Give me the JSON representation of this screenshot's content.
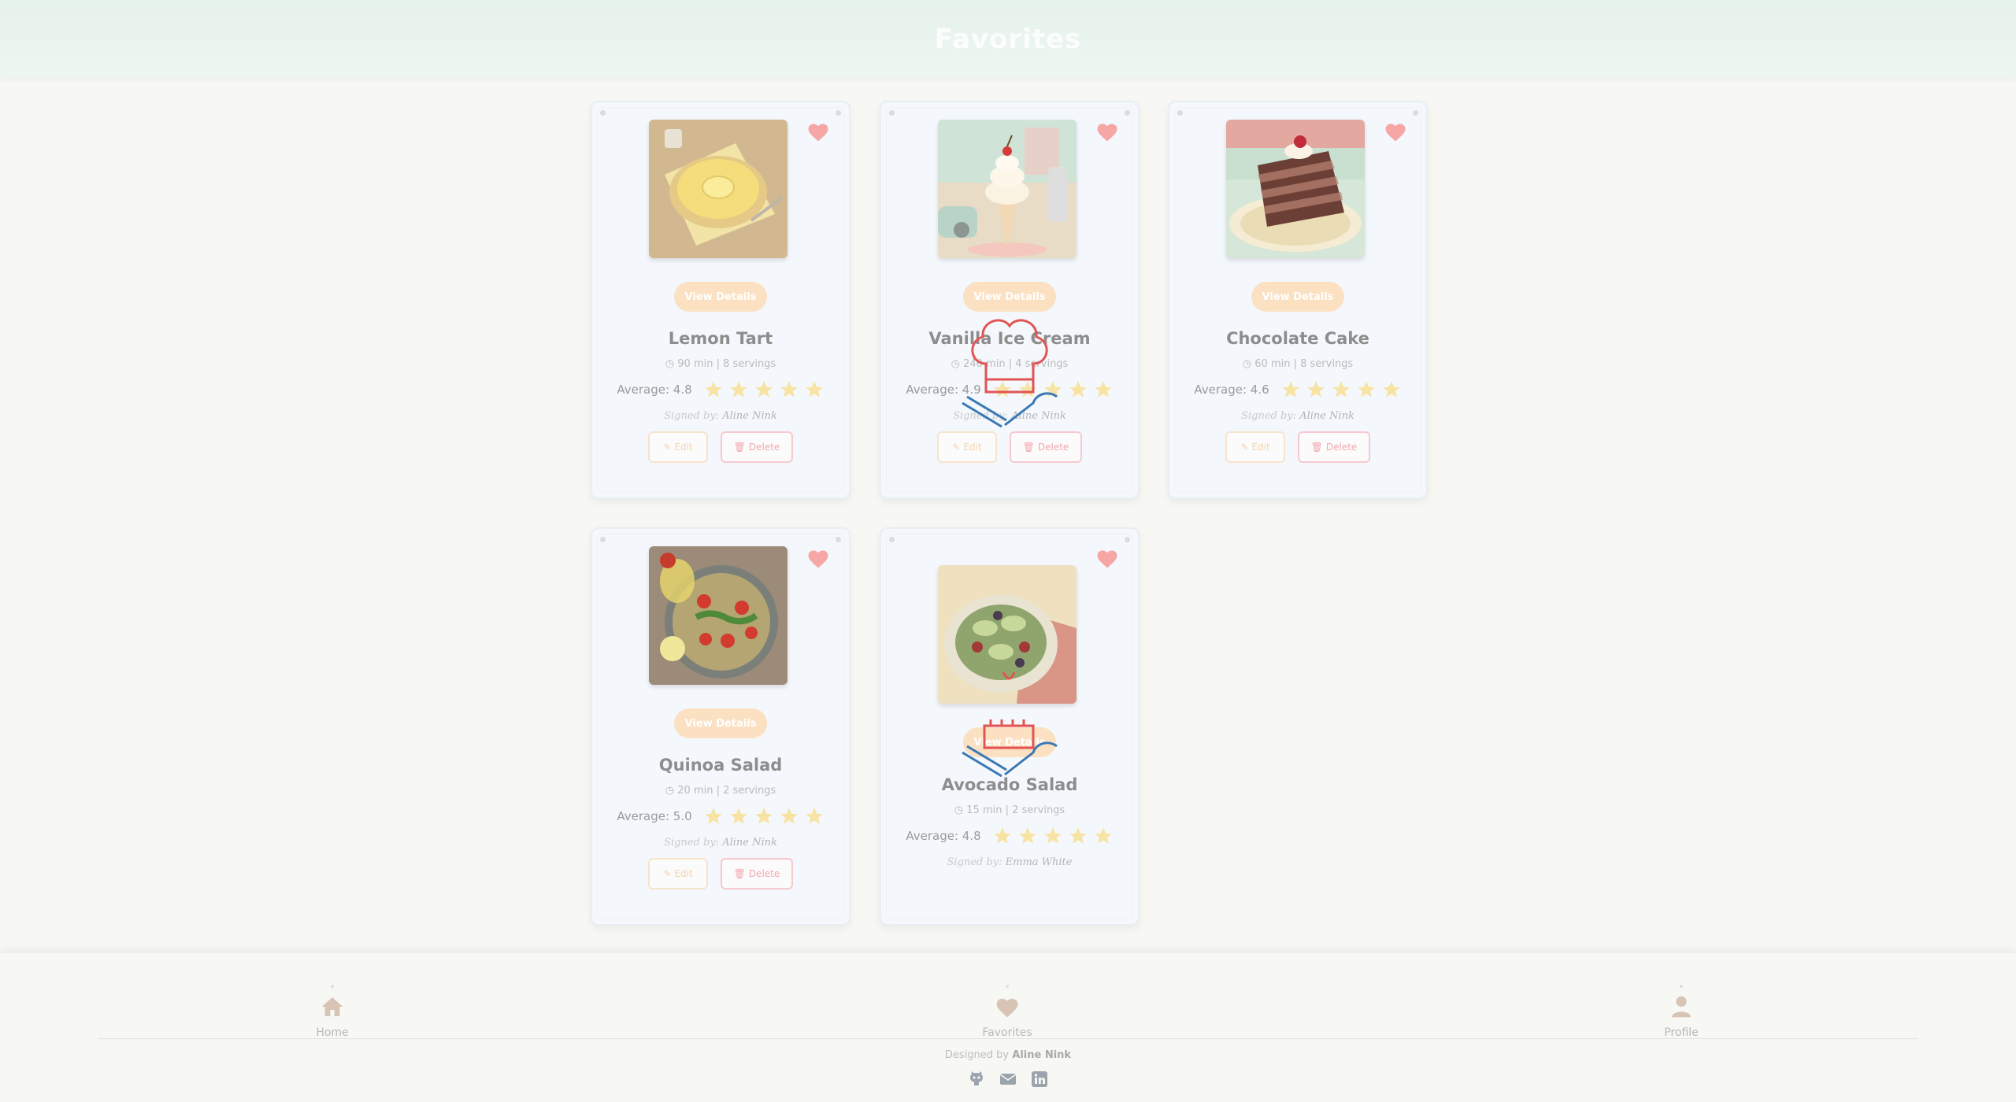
{
  "header": {
    "title": "Favorites"
  },
  "cards": [
    {
      "title": "Lemon Tart",
      "meta": "90 min | 8 servings",
      "average": "Average: 4.8",
      "stars": 5,
      "signed_prefix": "Signed by:",
      "author": "Aline Nink",
      "view_label": "View Details",
      "edit_label": "Edit",
      "delete_label": "Delete",
      "image_icon": "lemon-tart-image"
    },
    {
      "title": "Vanilla Ice Cream",
      "meta": "240 min | 4 servings",
      "average": "Average: 4.9",
      "stars": 5,
      "signed_prefix": "Signed by:",
      "author": "Aline Nink",
      "view_label": "View Details",
      "edit_label": "Edit",
      "delete_label": "Delete",
      "image_icon": "vanilla-ice-cream-image"
    },
    {
      "title": "Chocolate Cake",
      "meta": "60 min | 8 servings",
      "average": "Average: 4.6",
      "stars": 5,
      "signed_prefix": "Signed by:",
      "author": "Aline Nink",
      "view_label": "View Details",
      "edit_label": "Edit",
      "delete_label": "Delete",
      "image_icon": "chocolate-cake-image"
    },
    {
      "title": "Quinoa Salad",
      "meta": "20 min | 2 servings",
      "average": "Average: 5.0",
      "stars": 5,
      "signed_prefix": "Signed by:",
      "author": "Aline Nink",
      "view_label": "View Details",
      "edit_label": "Edit",
      "delete_label": "Delete",
      "image_icon": "quinoa-salad-image"
    },
    {
      "title": "Avocado Salad",
      "meta": "15 min | 2 servings",
      "average": "Average: 4.8",
      "stars": 5,
      "signed_prefix": "Signed by:",
      "author": "Emma White",
      "view_label": "View Details",
      "image_icon": "avocado-salad-image"
    }
  ],
  "nav": {
    "home": "Home",
    "favorites": "Favorites",
    "profile": "Profile"
  },
  "footer": {
    "designed_prefix": "Designed by",
    "designer": "Aline Nink",
    "social_icons": [
      "github-icon",
      "email-icon",
      "linkedin-icon"
    ]
  },
  "colors": {
    "header_bg": "#e6f2ec",
    "heart": "#f28b8b",
    "star": "#f7e3a3",
    "view_btn": "#fbe0c2",
    "delete_border": "#f7c9ce",
    "edit_border": "#f8e3cc"
  }
}
